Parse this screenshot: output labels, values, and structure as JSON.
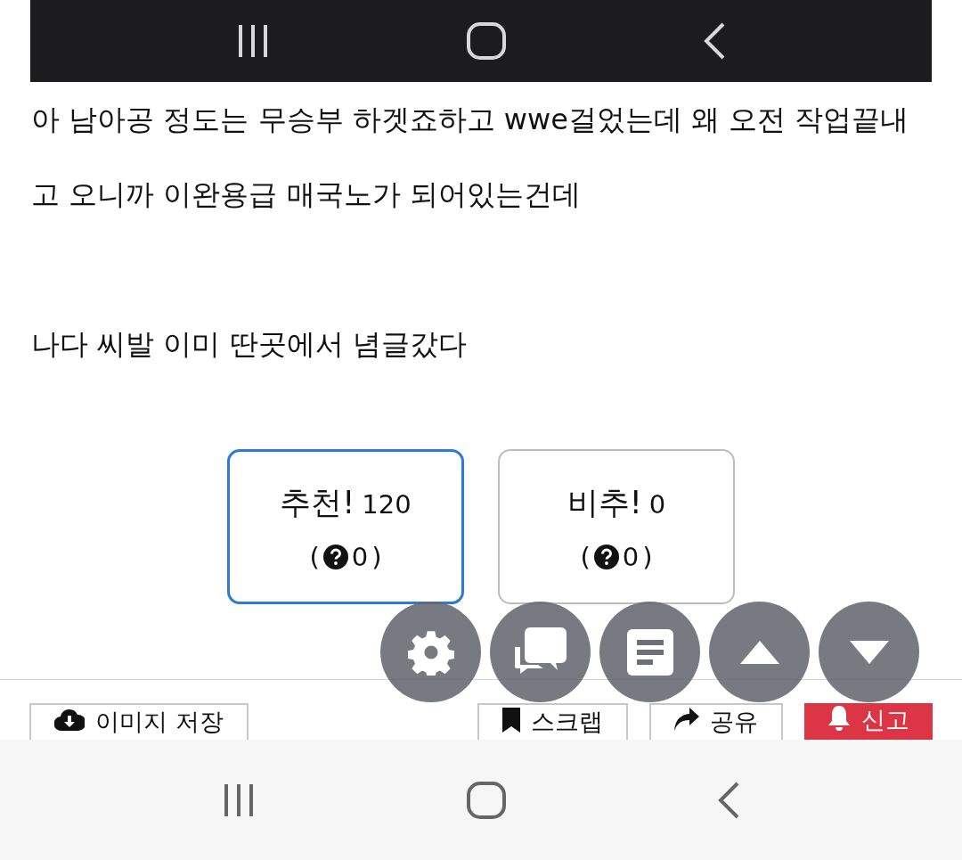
{
  "post": {
    "paragraphs": [
      "아 남아공 정도는 무승부 하겟죠하고 wwe걸었는데 왜 오전 작업끝내고 오니까 이완용급 매국노가 되어있는건데",
      "나다 씨발 이미 딴곳에서 념글갔다"
    ]
  },
  "votes": [
    {
      "label": "추천!",
      "count": "120",
      "open": "(",
      "sub_count": "0",
      "close": ")",
      "selected": true
    },
    {
      "label": "비추!",
      "count": "0",
      "open": "(",
      "sub_count": "0",
      "close": ")",
      "selected": false
    }
  ],
  "floating_buttons": [
    {
      "kind": "settings"
    },
    {
      "kind": "comments"
    },
    {
      "kind": "list"
    },
    {
      "kind": "up"
    },
    {
      "kind": "down"
    }
  ],
  "actions_left": [
    {
      "kind": "save",
      "label": "이미지 저장"
    }
  ],
  "actions_right": [
    {
      "kind": "scrap",
      "label": "스크랩"
    },
    {
      "kind": "share",
      "label": "공유"
    },
    {
      "kind": "report",
      "label": "신고"
    }
  ]
}
